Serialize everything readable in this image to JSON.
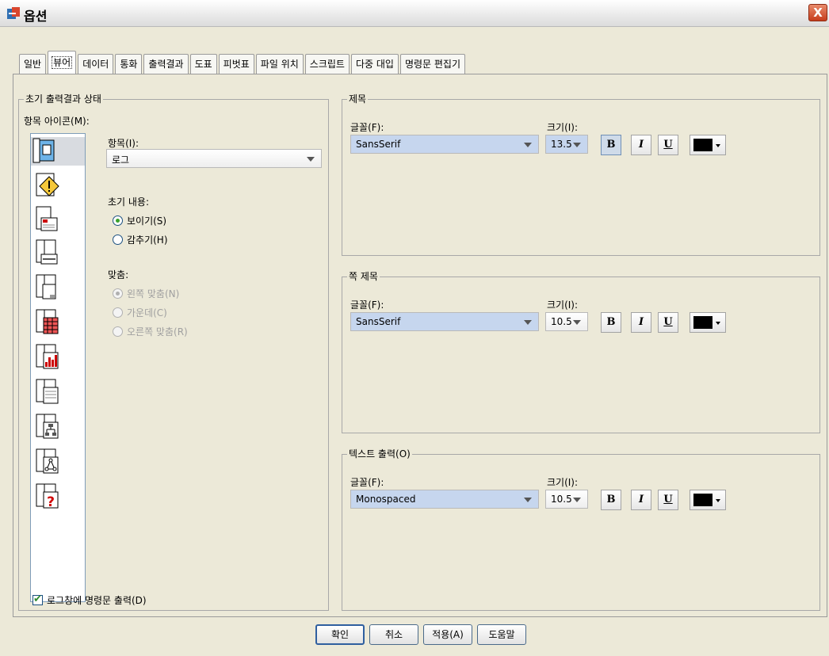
{
  "window": {
    "title": "옵션",
    "close_glyph": "X"
  },
  "tabs": [
    {
      "label": "일반"
    },
    {
      "label": "뷰어"
    },
    {
      "label": "데이터"
    },
    {
      "label": "통화"
    },
    {
      "label": "출력결과"
    },
    {
      "label": "도표"
    },
    {
      "label": "피벗표"
    },
    {
      "label": "파일 위치"
    },
    {
      "label": "스크립트"
    },
    {
      "label": "다중 대입"
    },
    {
      "label": "명령문 편집기"
    }
  ],
  "initial_output": {
    "legend": "초기 출력결과 상태",
    "icon_label": "항목 아이콘(M):",
    "item_label": "항목(I):",
    "item_value": "로그",
    "contents_label": "초기 내용:",
    "show_label": "보이기(S)",
    "hide_label": "감추기(H)",
    "align_label": "맞춤:",
    "align_left": "왼쪽 맞춤(N)",
    "align_center": "가운데(C)",
    "align_right": "오른쪽 맞춤(R)",
    "log_commands": "로그창에 명령문 출력(D)",
    "icons": [
      "log-icon",
      "warning-icon",
      "notes-icon",
      "title-icon",
      "page-title-icon",
      "pivot-table-icon",
      "chart-icon",
      "text-output-icon",
      "tree-diagram-icon",
      "model-icon",
      "unknown-object-icon"
    ]
  },
  "title_group": {
    "legend": "제목",
    "font_label": "글꼴(F):",
    "font_value": "SansSerif",
    "size_label": "크기(I):",
    "size_value": "13.5"
  },
  "page_title_group": {
    "legend": "쪽 제목",
    "font_label": "글꼴(F):",
    "font_value": "SansSerif",
    "size_label": "크기(I):",
    "size_value": "10.5"
  },
  "text_output_group": {
    "legend": "텍스트 출력(O)",
    "font_label": "글꼴(F):",
    "font_value": "Monospaced",
    "size_label": "크기(I):",
    "size_value": "10.5"
  },
  "style_buttons": {
    "bold": "B",
    "italic": "I",
    "underline": "U"
  },
  "buttons": {
    "ok": "확인",
    "cancel": "취소",
    "apply": "적용(A)",
    "help": "도움말"
  },
  "colors": {
    "accent": "#3aa12c",
    "background": "#ece9d8"
  }
}
